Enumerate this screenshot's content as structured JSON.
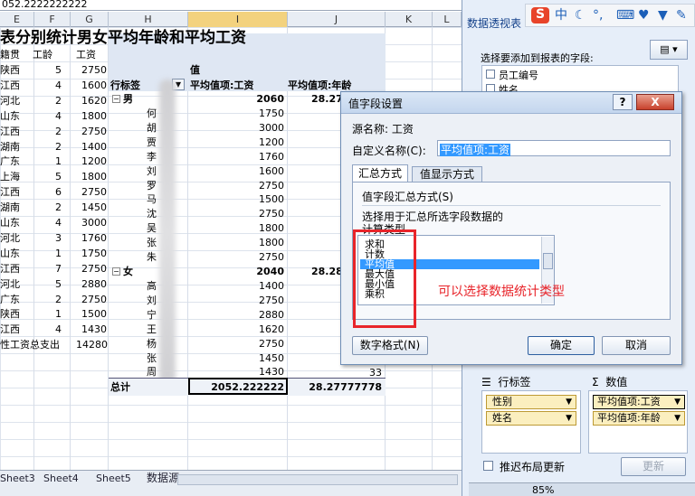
{
  "formula_bar": {
    "text": "052.2222222222"
  },
  "columns": [
    "E",
    "F",
    "G",
    "H",
    "I",
    "J",
    "K",
    "L"
  ],
  "sheet": {
    "title": "表分别统计男女平均年龄和平均工资",
    "headers": {
      "e": "籍贯",
      "f": "工龄",
      "g": "工资"
    },
    "rows": [
      {
        "e": "陕西",
        "f": "5",
        "g": "2750"
      },
      {
        "e": "江西",
        "f": "4",
        "g": "1600"
      },
      {
        "e": "河北",
        "f": "2",
        "g": "1620"
      },
      {
        "e": "山东",
        "f": "4",
        "g": "1800"
      },
      {
        "e": "江西",
        "f": "2",
        "g": "2750"
      },
      {
        "e": "湖南",
        "f": "2",
        "g": "1400"
      },
      {
        "e": "广东",
        "f": "1",
        "g": "1200"
      },
      {
        "e": "上海",
        "f": "5",
        "g": "1800"
      },
      {
        "e": "江西",
        "f": "6",
        "g": "2750"
      },
      {
        "e": "湖南",
        "f": "2",
        "g": "1450"
      },
      {
        "e": "山东",
        "f": "4",
        "g": "3000"
      },
      {
        "e": "河北",
        "f": "3",
        "g": "1760"
      },
      {
        "e": "山东",
        "f": "1",
        "g": "1750"
      },
      {
        "e": "江西",
        "f": "7",
        "g": "2750"
      },
      {
        "e": "河北",
        "f": "5",
        "g": "2880"
      },
      {
        "e": "广东",
        "f": "2",
        "g": "2750"
      },
      {
        "e": "陕西",
        "f": "1",
        "g": "1500"
      },
      {
        "e": "江西",
        "f": "4",
        "g": "1430"
      }
    ],
    "total_label": "性工资总支出",
    "total_value": "14280"
  },
  "pivot": {
    "values_header": "值",
    "row_label": "行标签",
    "col1": "平均值项:工资",
    "col2": "平均值项:年龄",
    "male": {
      "label": "男",
      "salary": "2060",
      "age": "28.27"
    },
    "male_rows": [
      {
        "name": "何",
        "salary": "1750"
      },
      {
        "name": "胡",
        "salary": "3000"
      },
      {
        "name": "贾",
        "salary": "1200"
      },
      {
        "name": "李",
        "salary": "1760"
      },
      {
        "name": "刘",
        "salary": "1600"
      },
      {
        "name": "罗",
        "salary": "2750"
      },
      {
        "name": "马",
        "salary": "1500"
      },
      {
        "name": "沈",
        "salary": "2750"
      },
      {
        "name": "吴",
        "salary": "1800"
      },
      {
        "name": "张",
        "salary": "1800"
      },
      {
        "name": "朱",
        "salary": "2750"
      }
    ],
    "female": {
      "label": "女",
      "salary": "2040",
      "age": "28.28"
    },
    "female_rows": [
      {
        "name": "高",
        "salary": "1400"
      },
      {
        "name": "刘",
        "salary": "2750"
      },
      {
        "name": "宁",
        "salary": "2880"
      },
      {
        "name": "王",
        "salary": "1620"
      },
      {
        "name": "杨",
        "salary": "2750"
      },
      {
        "name": "张",
        "salary": "1450"
      },
      {
        "name": "周",
        "salary": "1430"
      }
    ],
    "last_age": "33",
    "grand_total": {
      "label": "总计",
      "salary": "2052.222222",
      "age": "28.27777778"
    }
  },
  "sheet_tabs": [
    "Sheet3",
    "Sheet4",
    "Sheet5",
    "数据源"
  ],
  "task_pane": {
    "title": "数据透视表",
    "choose_fields": "选择要添加到报表的字段:",
    "fields": [
      "员工编号",
      "姓名"
    ],
    "row_area_label": "行标签",
    "values_area_label": "数值",
    "row_fields": [
      "性别",
      "姓名"
    ],
    "value_fields": [
      "平均值项:工资",
      "平均值项:年龄"
    ],
    "defer_update": "推迟布局更新",
    "update_button": "更新",
    "zoom": "85%"
  },
  "ime": {
    "logo": "S",
    "mode": "中"
  },
  "dialog": {
    "title": "值字段设置",
    "source_label": "源名称:",
    "source_value": "工资",
    "custom_name_label": "自定义名称(C):",
    "custom_name_value": "平均值项:工资",
    "tabs": [
      "汇总方式",
      "值显示方式"
    ],
    "group_title": "值字段汇总方式(S)",
    "description_line1": "选择用于汇总所选字段数据的",
    "description_line2": "计算类型",
    "options": [
      "求和",
      "计数",
      "平均值",
      "最大值",
      "最小值",
      "乘积"
    ],
    "selected_option": "平均值",
    "number_format_button": "数字格式(N)",
    "ok_button": "确定",
    "cancel_button": "取消",
    "help": "?",
    "close": "X"
  },
  "annotation": {
    "text": "可以选择数据统计类型",
    "color": "#e8242a"
  },
  "colors": {
    "selection": "#3399ff",
    "pivot_header": "#dfe7f3",
    "annotation": "#e8242a"
  }
}
